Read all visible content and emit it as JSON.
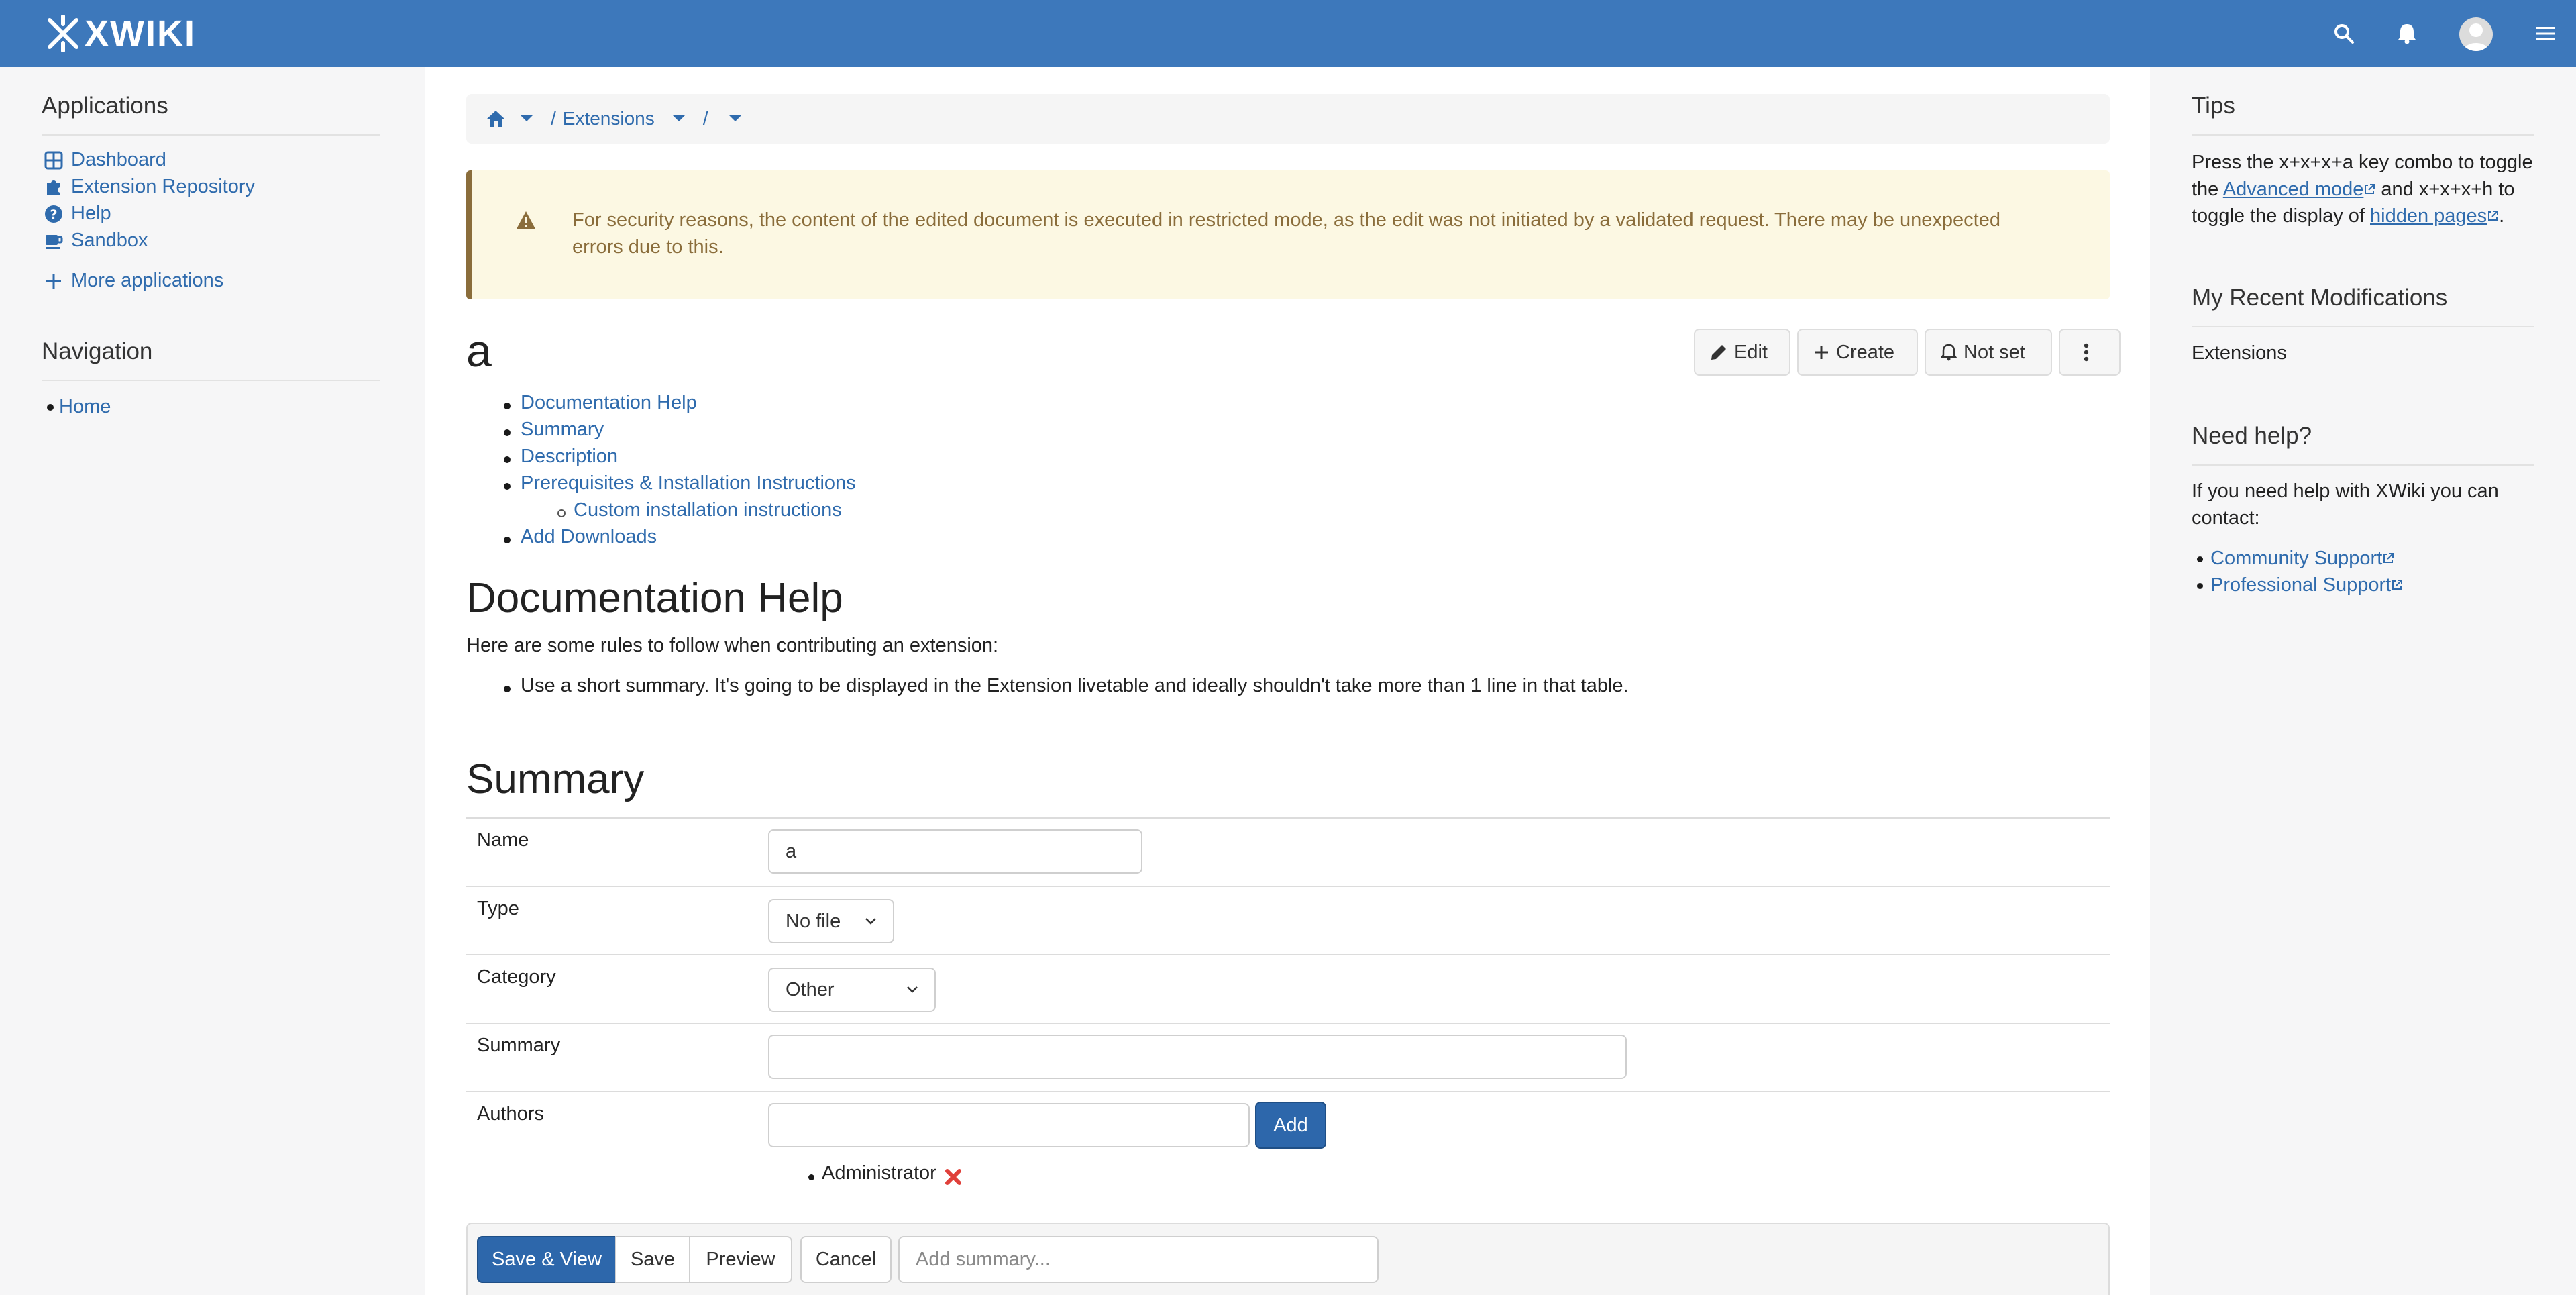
{
  "header": {
    "logo": "XWIKI"
  },
  "left": {
    "applications_title": "Applications",
    "applications": [
      {
        "label": "Dashboard",
        "icon": "dashboard-icon"
      },
      {
        "label": "Extension Repository",
        "icon": "puzzle-icon"
      },
      {
        "label": "Help",
        "icon": "help-icon"
      },
      {
        "label": "Sandbox",
        "icon": "coffee-icon"
      }
    ],
    "more_apps": "More applications",
    "navigation_title": "Navigation",
    "navigation": [
      {
        "label": "Home"
      }
    ]
  },
  "breadcrumb": {
    "items": [
      "/",
      "Extensions",
      "/"
    ]
  },
  "warning": {
    "text": "For security reasons, the content of the edited document is executed in restricted mode, as the edit was not initiated by a validated request. There may be unexpected errors due to this."
  },
  "page": {
    "title": "a",
    "actions": {
      "edit": "Edit",
      "create": "Create",
      "notify": "Not set"
    },
    "toc": [
      "Documentation Help",
      "Summary",
      "Description",
      "Prerequisites & Installation Instructions",
      "Custom installation instructions",
      "Add Downloads"
    ],
    "doc_help_heading": "Documentation Help",
    "doc_help_intro": "Here are some rules to follow when contributing an extension:",
    "doc_help_rule": "Use a short summary. It's going to be displayed in the Extension livetable and ideally shouldn't take more than 1 line in that table.",
    "summary_heading": "Summary"
  },
  "form": {
    "name_label": "Name",
    "name_value": "a",
    "type_label": "Type",
    "type_value": "No file",
    "category_label": "Category",
    "category_value": "Other",
    "summary_label": "Summary",
    "summary_value": "",
    "authors_label": "Authors",
    "authors_add": "Add",
    "author_entry": "Administrator"
  },
  "editbar": {
    "save_view": "Save & View",
    "save": "Save",
    "preview": "Preview",
    "cancel": "Cancel",
    "summary_placeholder": "Add summary..."
  },
  "right": {
    "tips_title": "Tips",
    "tips_part1": "Press the x+x+x+a key combo to toggle the ",
    "tips_link1": "Advanced mode",
    "tips_part2": " and x+x+x+h to toggle the display of ",
    "tips_link2": "hidden pages",
    "tips_part3": ".",
    "recent_title": "My Recent Modifications",
    "recent_item": "Extensions",
    "help_title": "Need help?",
    "help_text": "If you need help with XWiki you can contact:",
    "help_links": [
      "Community Support",
      "Professional Support"
    ]
  },
  "colors": {
    "brand": "#3d78bb",
    "link": "#2f6bad",
    "warning_bg": "#fcf8e3",
    "warning_text": "#8a6d3b",
    "primary_button": "#2d67ab"
  }
}
